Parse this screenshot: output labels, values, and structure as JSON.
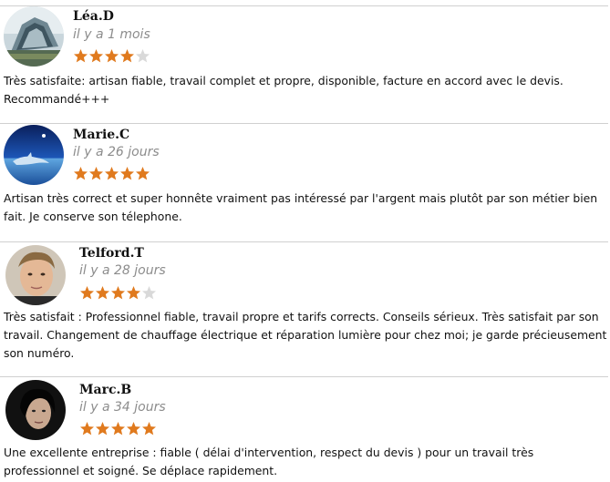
{
  "colors": {
    "star_filled": "#e07a1e",
    "star_empty": "#d9d9d9",
    "date_gray": "#8c8c8c"
  },
  "reviews": [
    {
      "author": "Léa.D",
      "date": "il y a 1 mois",
      "rating": 4,
      "max_rating": 5,
      "avatar_icon": "futuristic-building-avatar",
      "text": "Très satisfaite: artisan fiable, travail complet et propre, disponible, facture en accord avec le devis. Recommandé+++"
    },
    {
      "author": "Marie.C",
      "date": "il y a 26 jours",
      "rating": 5,
      "max_rating": 5,
      "avatar_icon": "dolphin-avatar",
      "text": "Artisan très correct et super honnête vraiment pas intéressé par l'argent mais plutôt par son métier bien fait. Je conserve son télephone."
    },
    {
      "author": "Telford.T",
      "date": "il y a 28 jours",
      "rating": 4,
      "max_rating": 5,
      "avatar_icon": "man-portrait-avatar",
      "text": "Très satisfait : Professionnel fiable, travail propre et tarifs corrects. Conseils sérieux. Très satisfait par son travail. Changement de chauffage électrique et réparation lumière pour chez moi; je garde précieusement son numéro."
    },
    {
      "author": "Marc.B",
      "date": "il y a 34 jours",
      "rating": 5,
      "max_rating": 5,
      "avatar_icon": "dark-portrait-avatar",
      "text": "Une excellente entreprise : fiable (  délai d'intervention, respect du devis ) pour un travail très professionnel  et soigné. Se déplace  rapidement."
    }
  ]
}
